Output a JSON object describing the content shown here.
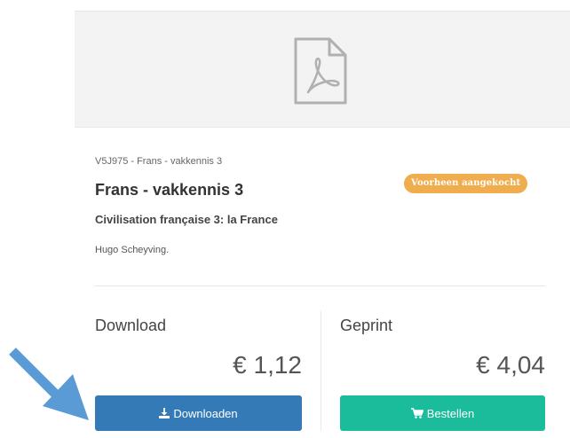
{
  "product": {
    "code_line": "V5J975 - Frans - vakkennis 3",
    "title": "Frans - vakkennis 3",
    "badge": "Voorheen aangekocht",
    "subtitle": "Civilisation française 3: la France",
    "author": "Hugo Scheyving."
  },
  "thumbnail": {
    "icon": "pdf-file-icon"
  },
  "download_option": {
    "label": "Download",
    "price": "€ 1,12",
    "button_label": "Downloaden",
    "button_icon": "download-icon",
    "button_color": "#337ab7"
  },
  "print_option": {
    "label": "Geprint",
    "price": "€ 4,04",
    "button_label": "Bestellen",
    "button_icon": "shopping-cart-icon",
    "button_color": "#1abc9c"
  },
  "colors": {
    "badge": "#f0ad4e",
    "annotation_arrow": "#5b9bd5"
  }
}
